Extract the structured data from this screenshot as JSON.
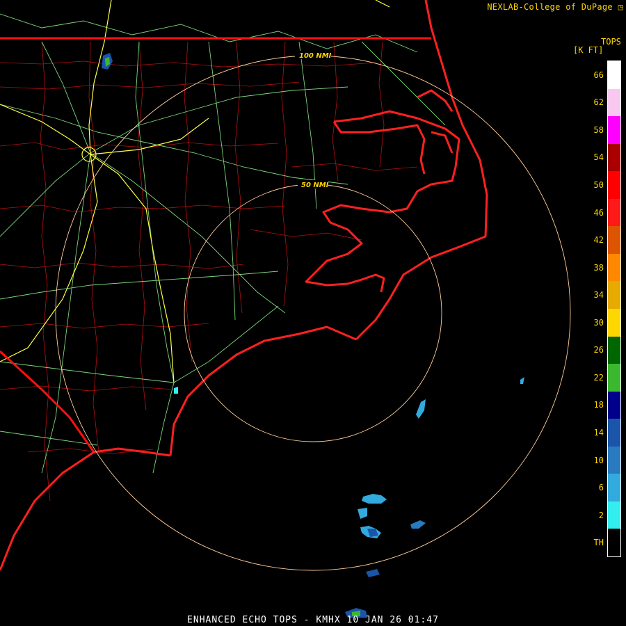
{
  "header": {
    "credit": "NEXLAB-College of DuPage"
  },
  "footer": {
    "product": "ENHANCED ECHO TOPS - KMHX 10 JAN 26 01:47"
  },
  "legend": {
    "title_line1": "TOPS",
    "title_line2": "[K FT]",
    "labels": [
      "66",
      "62",
      "58",
      "54",
      "50",
      "46",
      "42",
      "38",
      "34",
      "30",
      "26",
      "22",
      "18",
      "14",
      "10",
      "6",
      "2",
      "TH"
    ],
    "colors": [
      "#ffffff",
      "#f8c8f0",
      "#ff00ff",
      "#aa0000",
      "#ff0000",
      "#ff1a1a",
      "#dd5500",
      "#ff8800",
      "#e6aa00",
      "#ffd700",
      "#006600",
      "#3cb830",
      "#00008b",
      "#1a55aa",
      "#2a7ac0",
      "#33aadd",
      "#33eeee",
      "#000000"
    ]
  },
  "range_rings": [
    {
      "label": "100 NMI"
    },
    {
      "label": "50 NMI"
    }
  ],
  "colors": {
    "state_border": "#ff1010",
    "county_line": "#cc1010",
    "coast": "#ff2020",
    "roads": "#88ee88",
    "interstate": "#ffff44",
    "ring": "#ffcc99"
  }
}
